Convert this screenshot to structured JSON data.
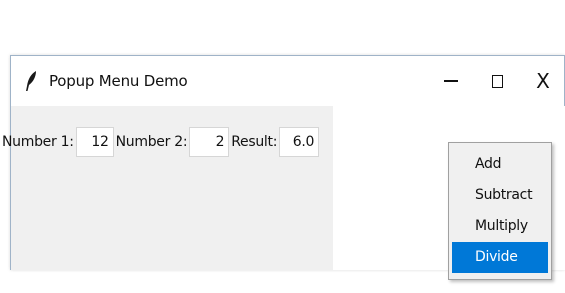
{
  "window": {
    "title": "Popup Menu Demo",
    "controls": {
      "minimize": "minimize-icon",
      "maximize": "maximize-icon",
      "close": "X"
    }
  },
  "form": {
    "number1_label": "Number 1:",
    "number1_value": "12",
    "number2_label": "Number 2:",
    "number2_value": "2",
    "result_label": "Result:",
    "result_value": "6.0"
  },
  "popup_menu": {
    "items": [
      {
        "label": "Add",
        "selected": false
      },
      {
        "label": "Subtract",
        "selected": false
      },
      {
        "label": "Multiply",
        "selected": false
      },
      {
        "label": "Divide",
        "selected": true
      }
    ],
    "highlight_color": "#0078d7"
  },
  "colors": {
    "client_background": "#f0f0f0",
    "window_border": "#9fb3c8"
  }
}
